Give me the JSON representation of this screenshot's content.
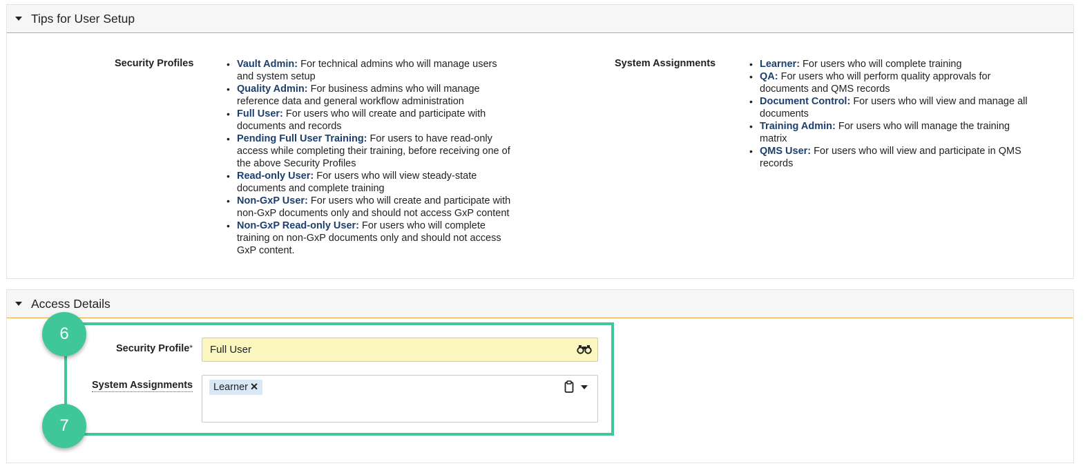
{
  "tips_section": {
    "title": "Tips for User Setup",
    "security_profiles": {
      "label": "Security Profiles",
      "items": [
        {
          "term": "Vault Admin:",
          "text": " For technical admins who will manage users and system setup"
        },
        {
          "term": "Quality Admin:",
          "text": " For business admins who will manage reference data and general workflow administration"
        },
        {
          "term": "Full User:",
          "text": " For users who will create and participate with documents and records"
        },
        {
          "term": "Pending Full User Training:",
          "text": " For users to have read-only access while completing their training, before receiving one of the above Security Profiles"
        },
        {
          "term": "Read-only User:",
          "text": " For users who will view steady-state documents and complete training"
        },
        {
          "term": "Non-GxP User:",
          "text": " For users who will create and participate with non-GxP documents only and should not access GxP content"
        },
        {
          "term": "Non-GxP Read-only User:",
          "text": " For users who will complete training on non-GxP documents only and should not access GxP content."
        }
      ]
    },
    "system_assignments": {
      "label": "System Assignments",
      "items": [
        {
          "term": "Learner:",
          "text": " For users who will complete training"
        },
        {
          "term": "QA:",
          "text": " For users who will perform quality approvals for documents and QMS records"
        },
        {
          "term": "Document Control:",
          "text": " For users who will view and manage all documents"
        },
        {
          "term": "Training Admin:",
          "text": " For users who will manage the training matrix"
        },
        {
          "term": "QMS User:",
          "text": " For users who will view and participate in QMS records"
        }
      ]
    }
  },
  "access_section": {
    "title": "Access Details",
    "security_profile": {
      "label": "Security Profile",
      "required": "*",
      "value": "Full User"
    },
    "system_assignments": {
      "label": "System Assignments",
      "chips": [
        {
          "label": "Learner",
          "remove": "✕"
        }
      ]
    }
  },
  "callouts": {
    "badge1": "6",
    "badge2": "7"
  },
  "colors": {
    "accent": "#3fc79a",
    "term": "#1d3f6e",
    "header_border": "#e8a33d",
    "field_yellow": "#fbf7bf",
    "chip": "#d9e8f7"
  }
}
